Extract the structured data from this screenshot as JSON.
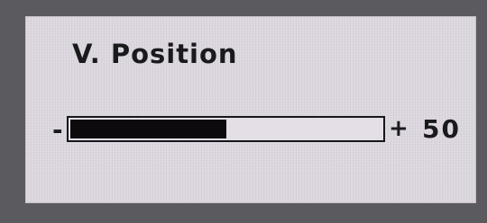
{
  "osd": {
    "title": "V. Position",
    "minus_label": "-",
    "plus_label": "+",
    "value": "50",
    "slider_level": 0.5,
    "colors": {
      "bezel": "#5b5a5e",
      "panel": "#dcd7df",
      "fill": "#0c0a0d"
    }
  }
}
